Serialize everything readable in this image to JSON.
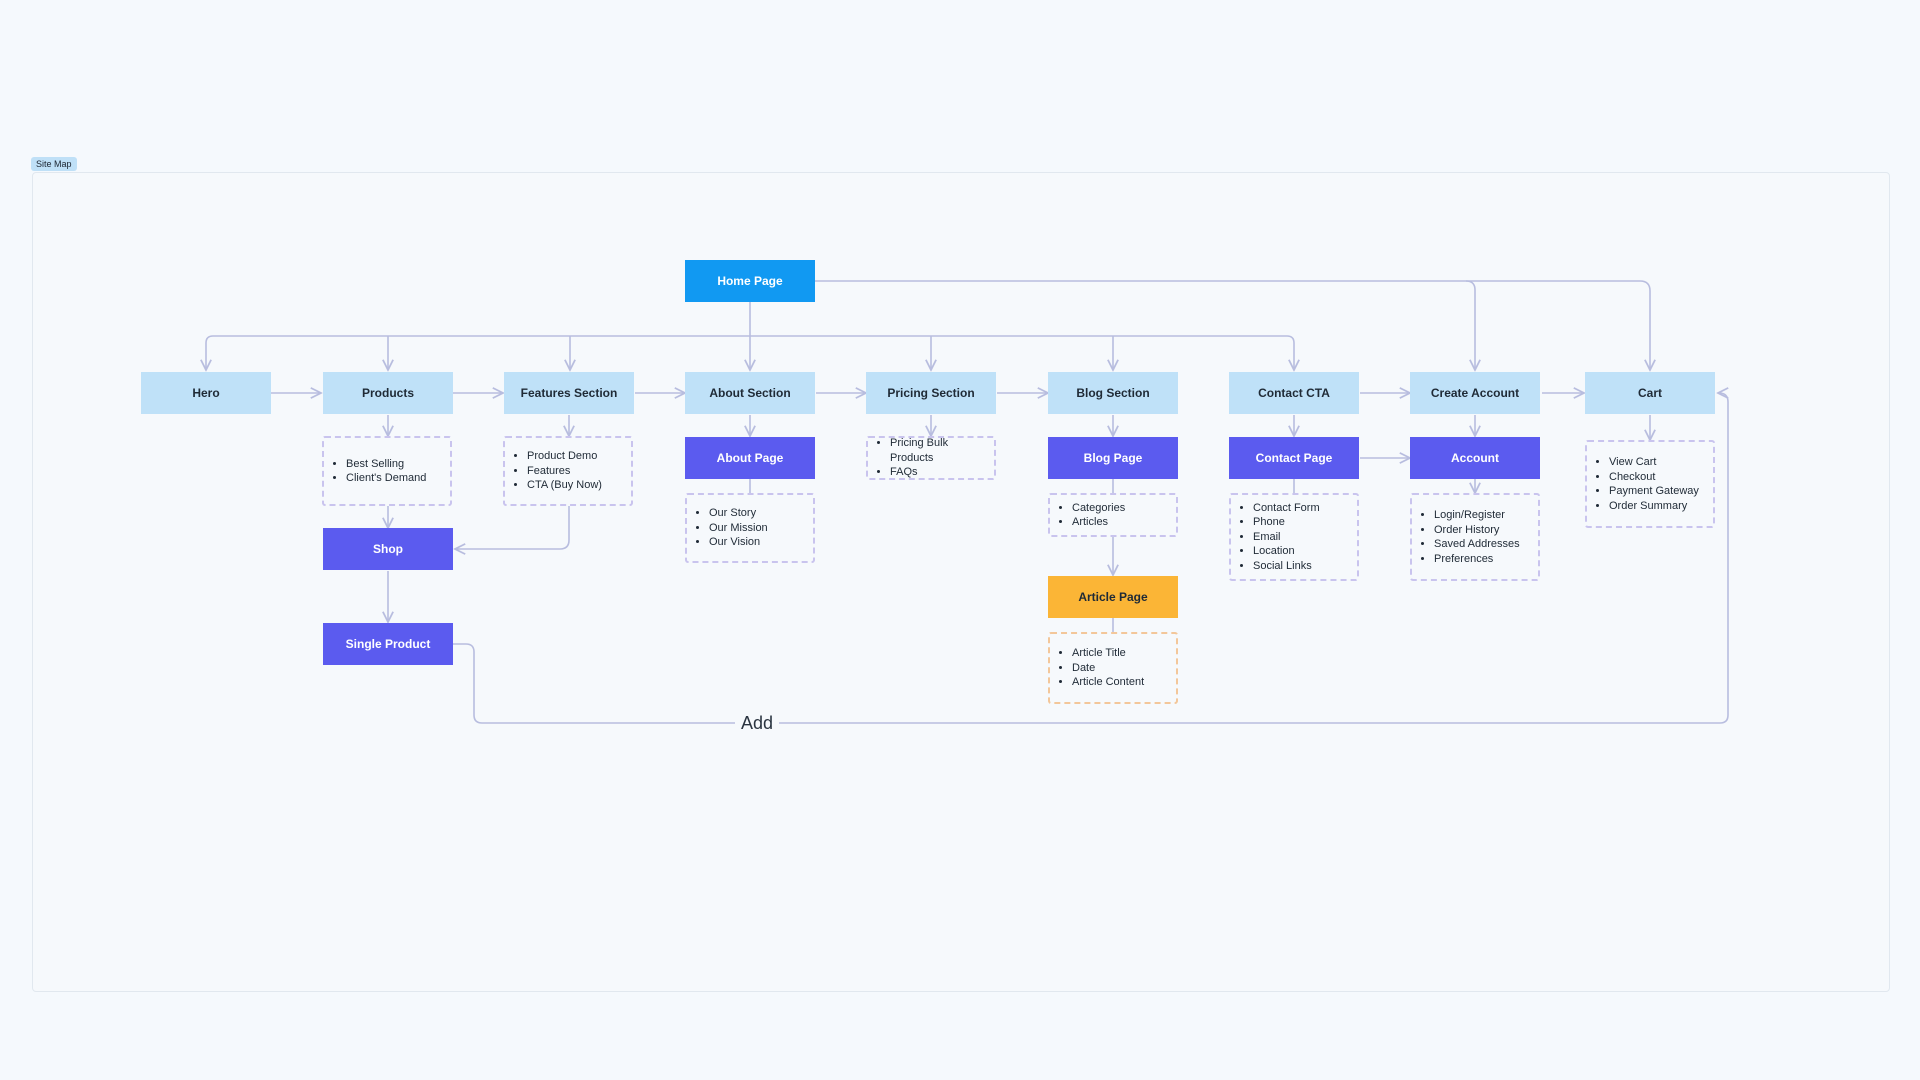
{
  "frame": {
    "tag": "Site Map"
  },
  "nodes": {
    "home": "Home Page",
    "hero": "Hero",
    "products": "Products",
    "features": "Features Section",
    "about_section": "About Section",
    "pricing": "Pricing Section",
    "blog_section": "Blog Section",
    "contact_cta": "Contact CTA",
    "create_account": "Create Account",
    "cart": "Cart",
    "shop": "Shop",
    "single_product": "Single Product",
    "about_page": "About Page",
    "blog_page": "Blog Page",
    "contact_page": "Contact Page",
    "account": "Account",
    "article_page": "Article Page"
  },
  "lists": {
    "products": [
      "Best Selling",
      "Client's Demand"
    ],
    "features": [
      "Product Demo",
      "Features",
      "CTA (Buy Now)"
    ],
    "about": [
      "Our Story",
      "Our Mission",
      "Our Vision"
    ],
    "pricing": [
      "Pricing Bulk Products",
      "FAQs"
    ],
    "blog": [
      "Categories",
      "Articles"
    ],
    "contact": [
      "Contact Form",
      "Phone",
      "Email",
      "Location",
      "Social Links"
    ],
    "account": [
      "Login/Register",
      "Order History",
      "Saved Addresses",
      "Preferences"
    ],
    "cart": [
      "View Cart",
      "Checkout",
      "Payment Gateway",
      "Order Summary"
    ],
    "article": [
      "Article Title",
      "Date",
      "Article Content"
    ]
  },
  "connector": {
    "add_label": "Add"
  },
  "colors": {
    "background": "#f5f9fd",
    "home": "#1199f2",
    "section": "#bfe1f8",
    "page": "#5b5bef",
    "article": "#fbb536",
    "wire": "#b8bddf",
    "list_border": "#c9c4ee"
  }
}
